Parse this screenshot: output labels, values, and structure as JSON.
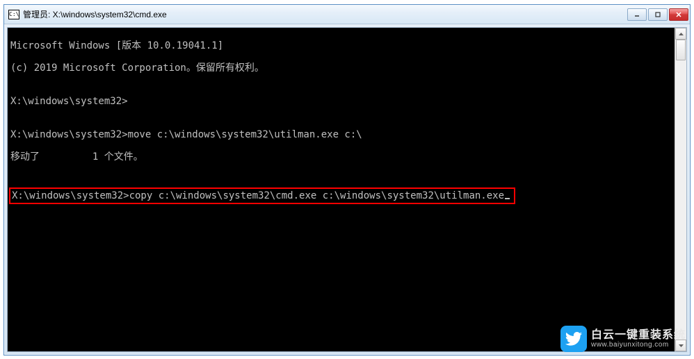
{
  "titlebar": {
    "icon_label": "C:\\",
    "title": "管理员: X:\\windows\\system32\\cmd.exe"
  },
  "terminal": {
    "line1": "Microsoft Windows [版本 10.0.19041.1]",
    "line2": "(c) 2019 Microsoft Corporation。保留所有权利。",
    "line3": "",
    "line4": "X:\\windows\\system32>",
    "line5": "",
    "line6": "X:\\windows\\system32>move c:\\windows\\system32\\utilman.exe c:\\",
    "line7": "移动了         1 个文件。",
    "line8": "",
    "highlight_prompt": "X:\\windows\\system32>",
    "highlight_cmd": "copy c:\\windows\\system32\\cmd.exe c:\\windows\\system32\\utilman.exe"
  },
  "watermark": {
    "main": "白云一键重装系统",
    "sub": "www.baiyunxitong.com"
  }
}
